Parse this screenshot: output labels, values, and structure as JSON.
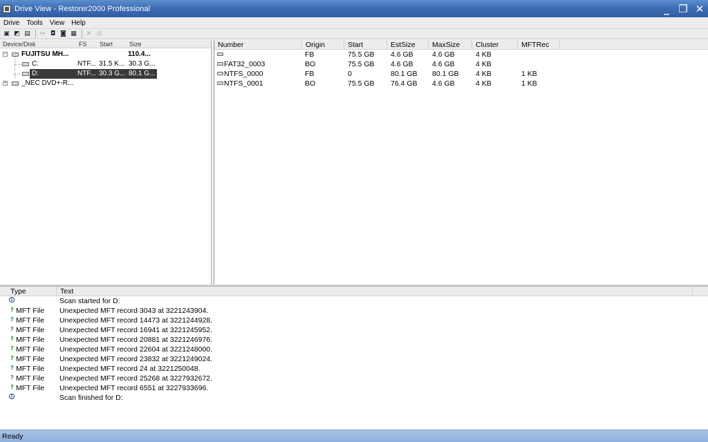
{
  "window": {
    "title": "Drive View - Restorer2000 Professional",
    "controls": {
      "minimize": "_",
      "restore": "❐",
      "close": "✕"
    }
  },
  "menu": [
    "Drive",
    "Tools",
    "View",
    "Help"
  ],
  "toolbar": {
    "icons": [
      "open-drive-icon",
      "open-image-icon",
      "print-icon",
      "swap-icon",
      "unlock-icon",
      "lock-icon",
      "save-icon",
      "cancel-icon",
      "disk-icon"
    ]
  },
  "tree": {
    "columns": [
      "Device/Disk",
      "FS",
      "Start",
      "Size"
    ],
    "rows": [
      {
        "name": "FUJITSU MH...",
        "fs": "",
        "start": "",
        "size": "110.4...",
        "bold": true,
        "expander": "−"
      },
      {
        "name": "C:",
        "fs": "NTF...",
        "start": "31.5 K...",
        "size": "30.3 G..."
      },
      {
        "name": "D:",
        "fs": "NTF...",
        "start": "30.3 G...",
        "size": "80.1 G...",
        "selected": true
      },
      {
        "name": "_NEC DVD+-R...",
        "fs": "",
        "start": "",
        "size": "",
        "expander": "+"
      }
    ]
  },
  "partitions": {
    "columns": [
      "Number",
      "Origin",
      "Start",
      "EstSize",
      "MaxSize",
      "Cluster",
      "MFTRec"
    ],
    "rows": [
      {
        "number": "",
        "origin": "FB",
        "start": "75.5 GB",
        "estsize": "4.6 GB",
        "maxsize": "4.6 GB",
        "cluster": "4 KB",
        "mftrec": ""
      },
      {
        "number": "FAT32_0003",
        "origin": "BO",
        "start": "75.5 GB",
        "estsize": "4.6 GB",
        "maxsize": "4.6 GB",
        "cluster": "4 KB",
        "mftrec": ""
      },
      {
        "number": "NTFS_0000",
        "origin": "FB",
        "start": "0",
        "estsize": "80.1 GB",
        "maxsize": "80.1 GB",
        "cluster": "4 KB",
        "mftrec": "1 KB"
      },
      {
        "number": "NTFS_0001",
        "origin": "BO",
        "start": "75.5 GB",
        "estsize": "76.4 GB",
        "maxsize": "4.6 GB",
        "cluster": "4 KB",
        "mftrec": "1 KB"
      }
    ]
  },
  "log": {
    "pin": "*",
    "columns": [
      "Type",
      "Text"
    ],
    "rows": [
      {
        "kind": "info",
        "type": "",
        "text": "Scan started for D:"
      },
      {
        "kind": "question",
        "type": "MFT File",
        "text": "Unexpected MFT record 3043 at 3221243904."
      },
      {
        "kind": "question",
        "type": "MFT File",
        "text": "Unexpected MFT record 14473 at 3221244928."
      },
      {
        "kind": "question",
        "type": "MFT File",
        "text": "Unexpected MFT record 16941 at 3221245952."
      },
      {
        "kind": "question",
        "type": "MFT File",
        "text": "Unexpected MFT record 20881 at 3221246976."
      },
      {
        "kind": "question",
        "type": "MFT File",
        "text": "Unexpected MFT record 22604 at 3221248000."
      },
      {
        "kind": "question",
        "type": "MFT File",
        "text": "Unexpected MFT record 23832 at 3221249024."
      },
      {
        "kind": "question",
        "type": "MFT File",
        "text": "Unexpected MFT record 24 at 3221250048."
      },
      {
        "kind": "question",
        "type": "MFT File",
        "text": "Unexpected MFT record 25268 at 3227932672."
      },
      {
        "kind": "question",
        "type": "MFT File",
        "text": "Unexpected MFT record 6551 at 3227933696."
      },
      {
        "kind": "info",
        "type": "",
        "text": "Scan finished for D:"
      }
    ]
  },
  "status": {
    "text": "Ready"
  },
  "colors": {
    "titlebar": "#3f6eb5",
    "statusbar": "#9bb8e2",
    "selection": "#3a3a3a"
  }
}
